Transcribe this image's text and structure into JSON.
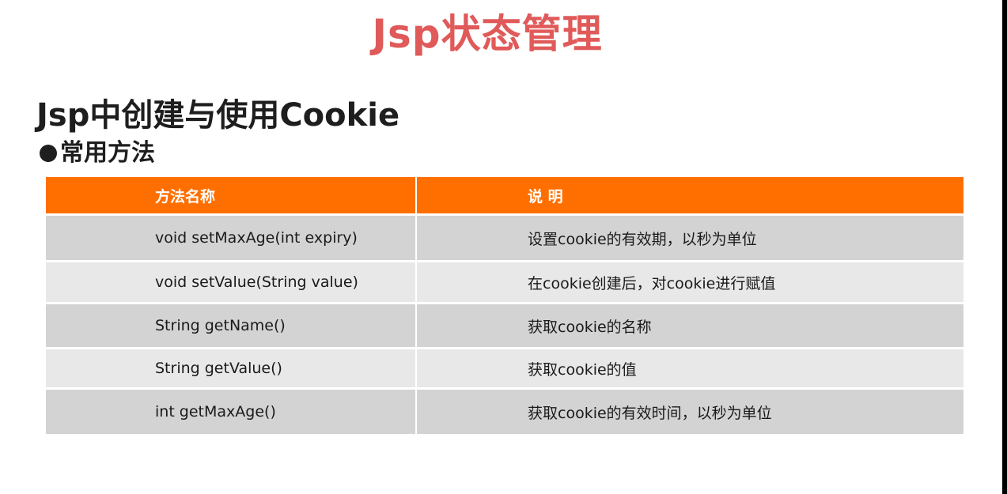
{
  "slide": {
    "title": "Jsp状态管理",
    "subtitle": "Jsp中创建与使用Cookie",
    "bullet": "常用方法"
  },
  "table": {
    "headers": [
      "方法名称",
      "说 明"
    ],
    "rows": [
      {
        "method": "void setMaxAge(int expiry)",
        "description": "设置cookie的有效期，以秒为单位"
      },
      {
        "method": "void setValue(String value)",
        "description": "在cookie创建后，对cookie进行赋值"
      },
      {
        "method": "String getName()",
        "description": "获取cookie的名称"
      },
      {
        "method": "String getValue()",
        "description": "获取cookie的值"
      },
      {
        "method": "int getMaxAge()",
        "description": "获取cookie的有效时间，以秒为单位"
      }
    ]
  },
  "colors": {
    "title": "#e05a5a",
    "header_bg": "#ff6f00",
    "row_dark": "#d3d3d3",
    "row_light": "#e8e8e8"
  },
  "icons": {
    "bullet": "filled-circle"
  }
}
